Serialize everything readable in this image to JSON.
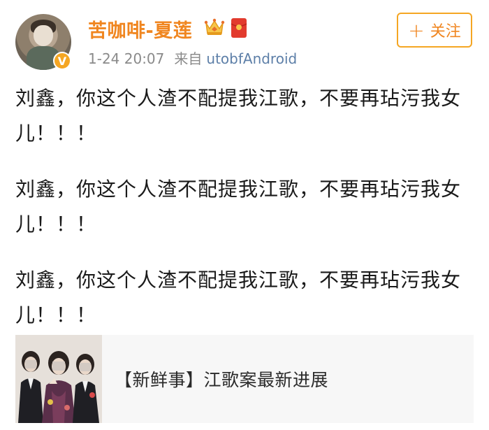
{
  "post": {
    "author": {
      "name": "苦咖啡-夏莲",
      "avatar_icon": "avatar-portrait",
      "verified_icon": "verified-v-badge",
      "badges": [
        "crown-icon",
        "red-packet-icon"
      ]
    },
    "meta": {
      "timestamp": "1-24 20:07",
      "source_label": "来自",
      "source_name": "utobfAndroid"
    },
    "follow_button": {
      "icon": "+",
      "label": "关注"
    },
    "paragraphs": [
      "刘鑫，你这个人渣不配提我江歌，不要再玷污我女儿！！！",
      "刘鑫，你这个人渣不配提我江歌，不要再玷污我女儿！！！",
      "刘鑫，你这个人渣不配提我江歌，不要再玷污我女儿！！！"
    ],
    "link_card": {
      "title": "【新鲜事】江歌案最新进展"
    }
  },
  "colors": {
    "username": "#f08620",
    "accent_border": "#f5a623",
    "source_link": "#5d7fa8",
    "meta_text": "#8a8a8a",
    "card_bg": "#f7f7f7"
  }
}
